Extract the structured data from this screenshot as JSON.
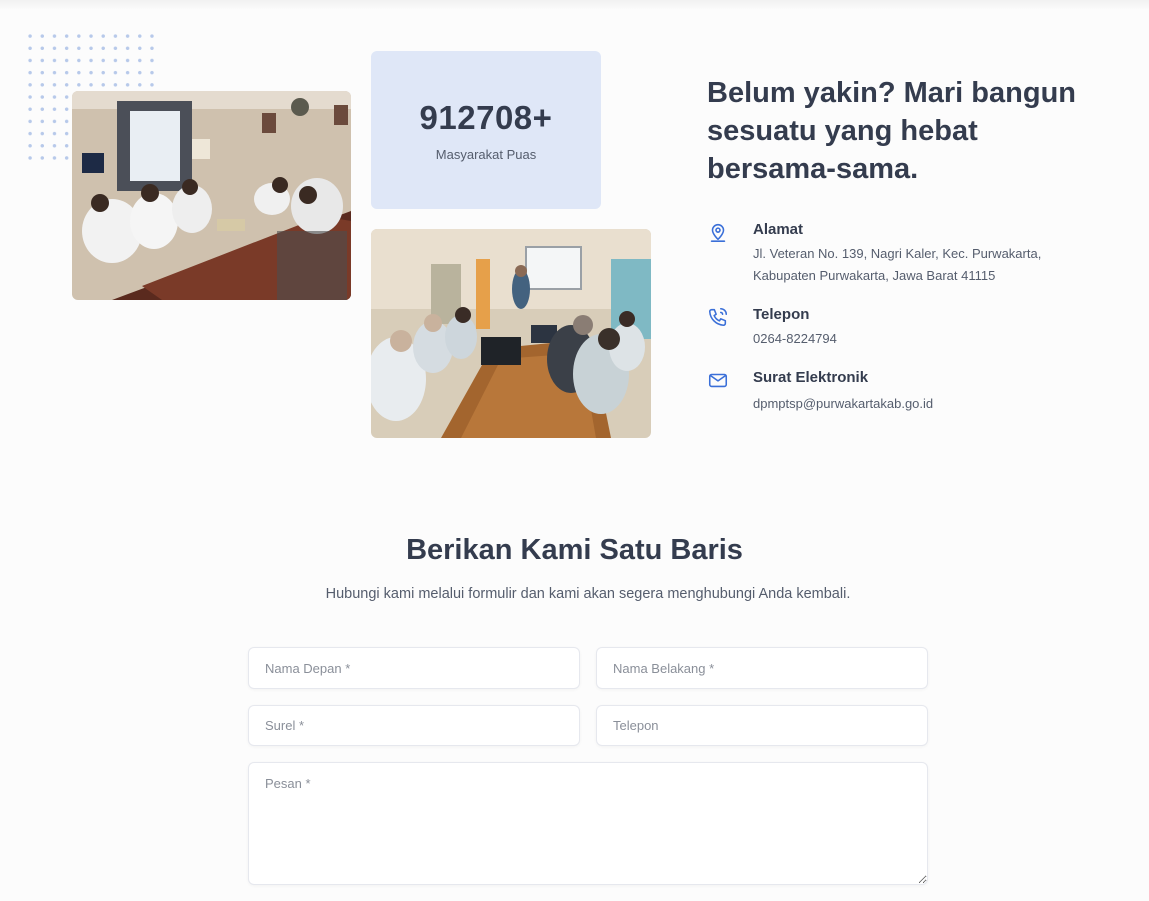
{
  "stats": {
    "number": "912708+",
    "label": "Masyarakat Puas"
  },
  "cta": {
    "headline": "Belum yakin? Mari bangun sesuatu yang hebat bersama-sama."
  },
  "contacts": {
    "address": {
      "icon": "map-pin-icon",
      "title": "Alamat",
      "text": "Jl. Veteran No. 139, Nagri Kaler, Kec. Purwakarta, Kabupaten Purwakarta, Jawa Barat 41115"
    },
    "phone": {
      "icon": "phone-icon",
      "title": "Telepon",
      "text": "0264-8224794"
    },
    "email": {
      "icon": "mail-icon",
      "title": "Surat Elektronik",
      "text": "dpmptsp@purwakartakab.go.id"
    }
  },
  "form": {
    "title": "Berikan Kami Satu Baris",
    "subtitle": "Hubungi kami melalui formulir dan kami akan segera menghubungi Anda kembali.",
    "first_name_placeholder": "Nama Depan *",
    "last_name_placeholder": "Nama Belakang *",
    "email_placeholder": "Surel *",
    "phone_placeholder": "Telepon",
    "message_placeholder": "Pesan *"
  },
  "colors": {
    "accent": "#3a6fd8",
    "stat_card_bg": "#dfe7f7",
    "heading": "#343c4e",
    "body_text": "#555d6d"
  }
}
